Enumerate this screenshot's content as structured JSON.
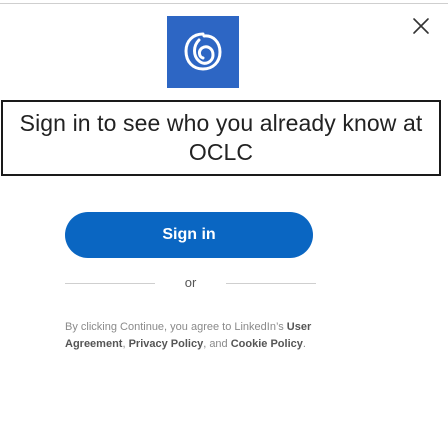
{
  "modal": {
    "close_icon": "close-icon",
    "logo_icon": "linkedin-bug-icon",
    "heading": "Sign in to see who you already know at OCLC",
    "signin_label": "Sign in",
    "divider_text": "or",
    "legal": {
      "prefix": "By clicking Continue, you agree to LinkedIn’s",
      "user_agreement": "User Agreement",
      "sep1": ", ",
      "privacy_policy": "Privacy Policy",
      "sep2": ", and ",
      "cookie_policy": "Cookie Policy",
      "suffix": "."
    }
  }
}
